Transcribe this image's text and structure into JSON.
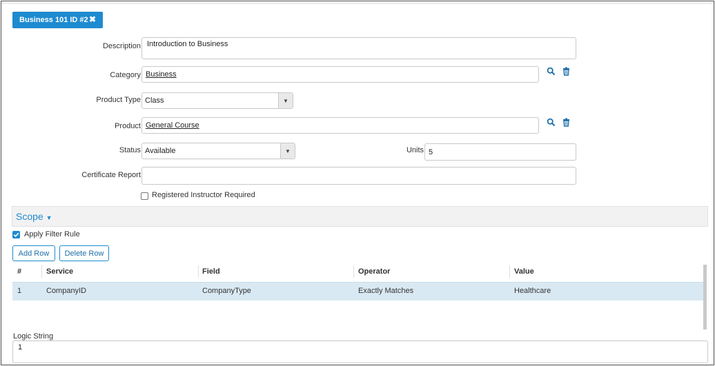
{
  "tab": {
    "label": "Business 101 ID #2",
    "close": "✖"
  },
  "form": {
    "description": {
      "label": "Description",
      "value": "Introduction to Business"
    },
    "category": {
      "label": "Category",
      "value": "Business"
    },
    "product_type": {
      "label": "Product Type",
      "value": "Class"
    },
    "product": {
      "label": "Product",
      "value": "General Course"
    },
    "status": {
      "label": "Status",
      "value": "Available"
    },
    "units": {
      "label": "Units",
      "value": "5"
    },
    "certificate_report": {
      "label": "Certificate Report",
      "value": ""
    },
    "registered_instructor": {
      "label": "Registered Instructor Required",
      "checked": false
    }
  },
  "scope": {
    "title": "Scope",
    "apply_filter": {
      "label": "Apply Filter Rule",
      "checked": true
    },
    "add_row": "Add Row",
    "delete_row": "Delete Row",
    "columns": [
      "#",
      "Service",
      "Field",
      "Operator",
      "Value"
    ],
    "rows": [
      {
        "num": "1",
        "service": "CompanyID",
        "field": "CompanyType",
        "operator": "Exactly Matches",
        "value": "Healthcare"
      }
    ],
    "logic_label": "Logic String",
    "logic_value": "1"
  },
  "colors": {
    "accent": "#1e8bd0",
    "selected_row": "#d9e9f3"
  }
}
